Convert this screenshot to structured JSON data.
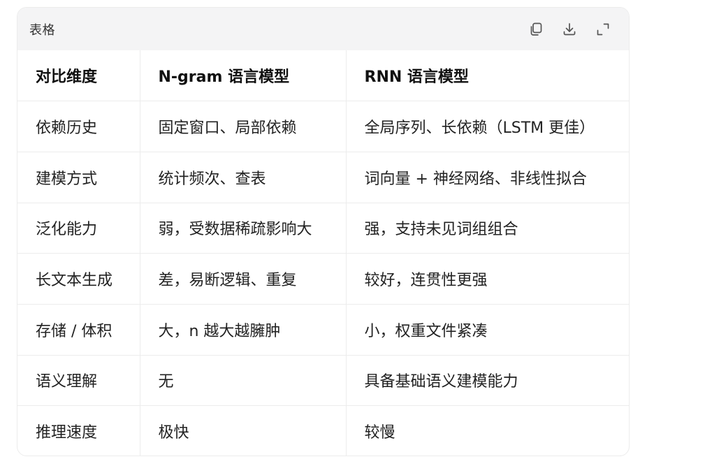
{
  "header": {
    "title": "表格",
    "actions": [
      {
        "name": "copy-icon",
        "label": "copy"
      },
      {
        "name": "download-icon",
        "label": "download"
      },
      {
        "name": "expand-icon",
        "label": "expand"
      }
    ]
  },
  "table": {
    "columns": [
      "对比维度",
      "N-gram 语言模型",
      "RNN 语言模型"
    ],
    "rows": [
      [
        "依赖历史",
        "固定窗口、局部依赖",
        "全局序列、长依赖（LSTM 更佳）"
      ],
      [
        "建模方式",
        "统计频次、查表",
        "词向量 + 神经网络、非线性拟合"
      ],
      [
        "泛化能力",
        "弱，受数据稀疏影响大",
        "强，支持未见词组组合"
      ],
      [
        "长文本生成",
        "差，易断逻辑、重复",
        "较好，连贯性更强"
      ],
      [
        "存储 / 体积",
        "大，n 越大越臃肿",
        "小，权重文件紧凑"
      ],
      [
        "语义理解",
        "无",
        "具备基础语义建模能力"
      ],
      [
        "推理速度",
        "极快",
        "较慢"
      ]
    ]
  },
  "colors": {
    "header_bg": "#f4f4f5",
    "border": "#ececec",
    "icon": "#555555"
  }
}
